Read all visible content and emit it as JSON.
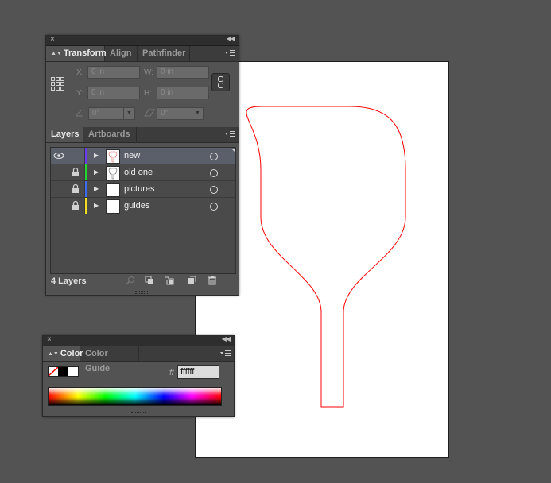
{
  "transform_panel": {
    "tabs": [
      {
        "label": "Transform",
        "active": true
      },
      {
        "label": "Align",
        "active": false
      },
      {
        "label": "Pathfinder",
        "active": false
      }
    ],
    "x_label": "X:",
    "x_value": "0 in",
    "y_label": "Y:",
    "y_value": "0 in",
    "w_label": "W:",
    "w_value": "0 in",
    "h_label": "H:",
    "h_value": "0 in",
    "rotate_value": "0°",
    "shear_value": "0°"
  },
  "layers_panel": {
    "tabs": [
      {
        "label": "Layers",
        "active": true
      },
      {
        "label": "Artboards",
        "active": false
      }
    ],
    "layers": [
      {
        "name": "new",
        "color": "#6a3cf0",
        "visible": true,
        "locked": false,
        "selected": true
      },
      {
        "name": "old one",
        "color": "#25d830",
        "visible": false,
        "locked": true,
        "selected": false
      },
      {
        "name": "pictures",
        "color": "#3c6cf0",
        "visible": false,
        "locked": true,
        "selected": false
      },
      {
        "name": "guides",
        "color": "#f0e020",
        "visible": false,
        "locked": true,
        "selected": false
      }
    ],
    "count_text": "4 Layers"
  },
  "color_panel": {
    "tabs": [
      {
        "label": "Color",
        "active": true
      },
      {
        "label": "Color Guide",
        "active": false
      }
    ],
    "hex_label": "#",
    "hex_value": "ffffff"
  },
  "colors": {
    "artwork_stroke": "#ff0000",
    "workspace_bg": "#535353"
  }
}
